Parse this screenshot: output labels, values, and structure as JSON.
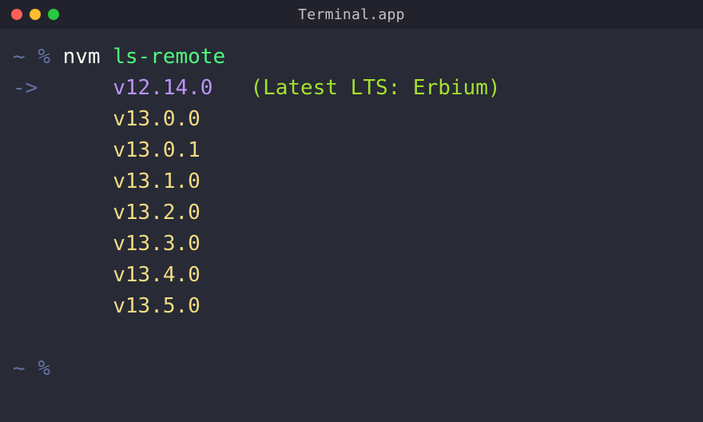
{
  "window": {
    "title": "Terminal.app"
  },
  "prompt": {
    "ps1_tilde": "~",
    "ps1_sep": "%",
    "command_bin": "nvm",
    "command_arg": "ls-remote",
    "arrow": "->"
  },
  "output": {
    "current_version": "v12.14.0",
    "current_note": "(Latest LTS: Erbium)",
    "versions": [
      "v13.0.0",
      "v13.0.1",
      "v13.1.0",
      "v13.2.0",
      "v13.3.0",
      "v13.4.0",
      "v13.5.0"
    ]
  },
  "colors": {
    "bg": "#282a36",
    "titlebar_bg": "#21222c",
    "dim": "#6272a4",
    "white": "#f8f8f2",
    "green": "#50fa7b",
    "purple": "#bd93f9",
    "yellow": "#f1dc83",
    "lime": "#a4e22e",
    "close": "#ff5f56",
    "min": "#ffbd2e",
    "max": "#27c93f"
  }
}
